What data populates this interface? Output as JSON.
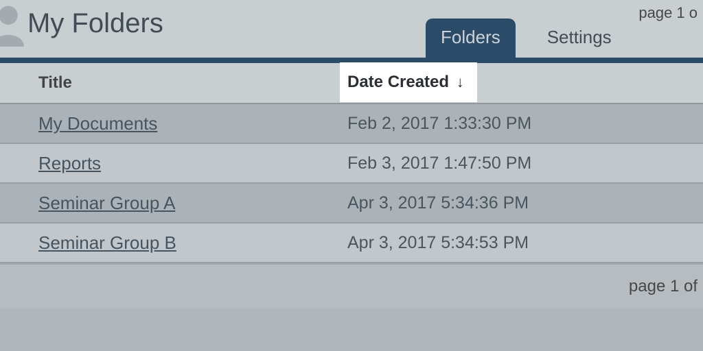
{
  "header": {
    "title": "My Folders",
    "top_pager": "page 1 o",
    "tabs": {
      "folders": "Folders",
      "settings": "Settings"
    }
  },
  "columns": {
    "title": "Title",
    "date_created": "Date Created",
    "sort_indicator": "↓"
  },
  "rows": [
    {
      "title": "My Documents",
      "date": "Feb 2, 2017 1:33:30 PM"
    },
    {
      "title": "Reports",
      "date": "Feb 3, 2017 1:47:50 PM"
    },
    {
      "title": "Seminar Group A",
      "date": "Apr 3, 2017 5:34:36 PM"
    },
    {
      "title": "Seminar Group B",
      "date": "Apr 3, 2017 5:34:53 PM"
    }
  ],
  "footer": {
    "bottom_pager": "page 1 of"
  }
}
